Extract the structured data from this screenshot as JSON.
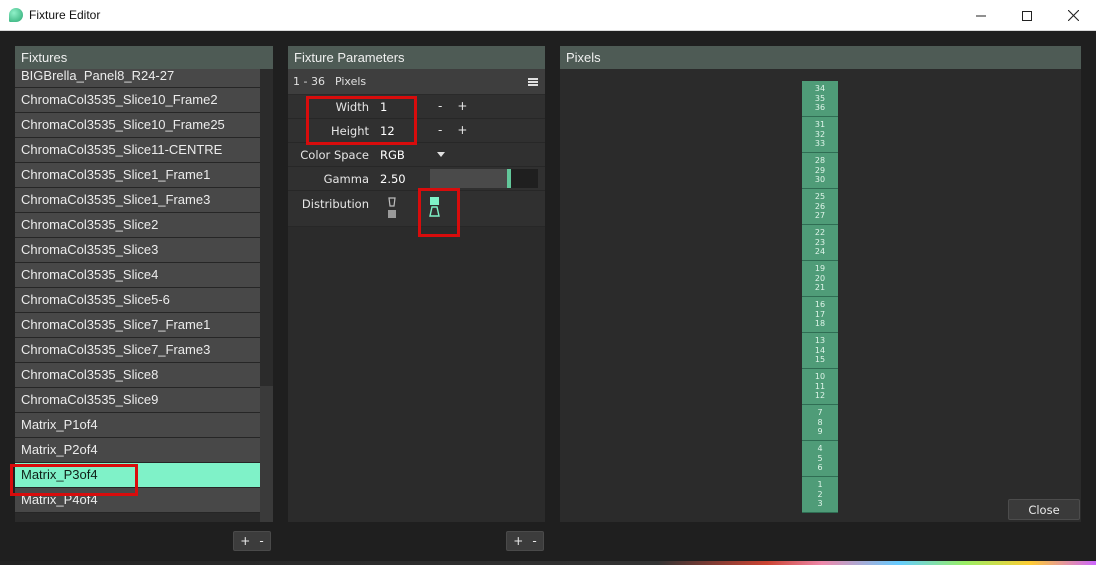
{
  "window": {
    "title": "Fixture Editor",
    "controls": [
      "minimize-icon",
      "maximize-icon",
      "close-icon"
    ]
  },
  "fixtures_panel": {
    "header": "Fixtures",
    "items": [
      "BIGBrella_Panel8_R24-27",
      "ChromaCol3535_Slice10_Frame2",
      "ChromaCol3535_Slice10_Frame25",
      "ChromaCol3535_Slice11-CENTRE",
      "ChromaCol3535_Slice1_Frame1",
      "ChromaCol3535_Slice1_Frame3",
      "ChromaCol3535_Slice2",
      "ChromaCol3535_Slice3",
      "ChromaCol3535_Slice4",
      "ChromaCol3535_Slice5-6",
      "ChromaCol3535_Slice7_Frame1",
      "ChromaCol3535_Slice7_Frame3",
      "ChromaCol3535_Slice8",
      "ChromaCol3535_Slice9",
      "Matrix_P1of4",
      "Matrix_P2of4",
      "Matrix_P3of4",
      "Matrix_P4of4"
    ],
    "selected": "Matrix_P3of4",
    "add_label": "+",
    "remove_label": "-"
  },
  "parameters_panel": {
    "header": "Fixture Parameters",
    "range": "1 - 36",
    "section": "Pixels",
    "width_label": "Width",
    "width_value": "1",
    "height_label": "Height",
    "height_value": "12",
    "minus": "-",
    "plus": "+",
    "color_space_label": "Color Space",
    "color_space_value": "RGB",
    "gamma_label": "Gamma",
    "gamma_value": "2.50",
    "gamma_slider_level": 0.73,
    "distribution_label": "Distribution",
    "add_label": "+",
    "remove_label": "-"
  },
  "pixels_panel": {
    "header": "Pixels",
    "cells": [
      "34\n35\n36",
      "31\n32\n33",
      "28\n29\n30",
      "25\n26\n27",
      "22\n23\n24",
      "19\n20\n21",
      "16\n17\n18",
      "13\n14\n15",
      "10\n11\n12",
      "7\n8\n9",
      "4\n5\n6",
      "1\n2\n3"
    ]
  },
  "footer": {
    "close_label": "Close"
  },
  "colors": {
    "panel_header": "#4e5b55",
    "selected_item": "#7ff2c8",
    "pixel_cell": "#4f9c78",
    "annotation_red": "#d80c0c"
  }
}
